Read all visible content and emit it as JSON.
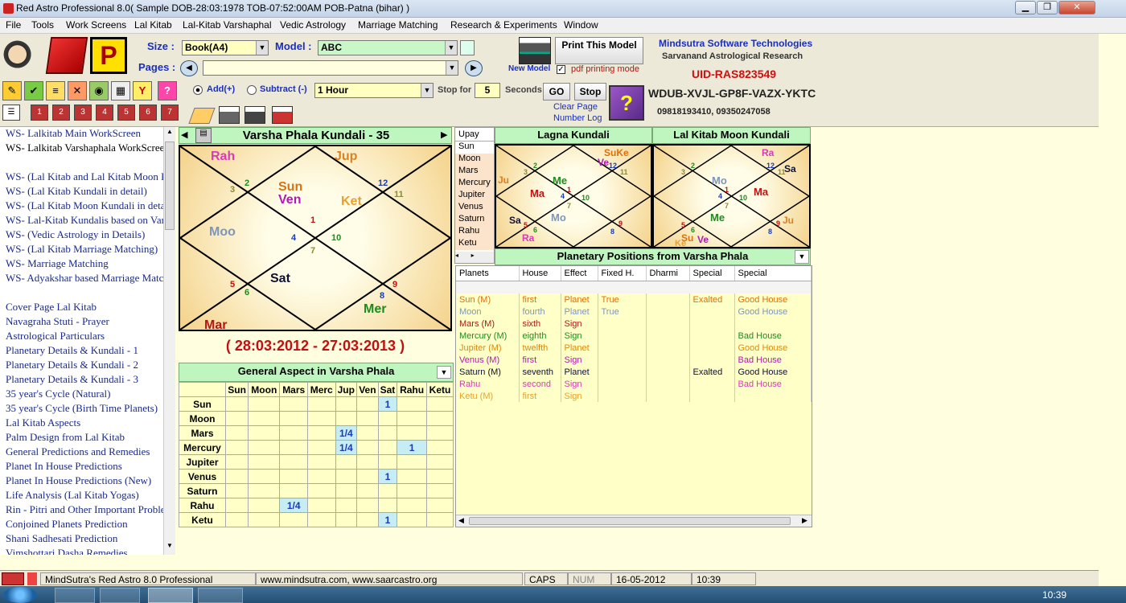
{
  "window": {
    "title": "Red Astro Professional 8.0( Sample DOB-28:03:1978 TOB-07:52:00AM POB-Patna (bihar) )",
    "minimize": "▁",
    "maximize": "❐",
    "close": "✕"
  },
  "menu": [
    "File",
    "Tools",
    "Work Screens",
    "Lal Kitab",
    "Lal-Kitab Varshaphal",
    "Vedic Astrology",
    "Marriage Matching",
    "Research & Experiments",
    "Window"
  ],
  "toolbar": {
    "size_label": "Size :",
    "size_value": "Book(A4)",
    "model_label": "Model :",
    "model_value": "ABC",
    "pages_label": "Pages :",
    "pages_value": "",
    "new_model": "New Model",
    "print_this_model": "Print This Model",
    "pdf_mode": "pdf printing mode",
    "company": "Mindsutra Software Technologies",
    "research": "Sarvanand Astrological Research",
    "uid": "UID-RAS823549",
    "key": "WDUB-XVJL-GP8F-VAZX-YKTC",
    "phones": "09818193410, 09350247058",
    "add": "Add(+)",
    "subtract": "Subtract (-)",
    "interval": "1 Hour",
    "stop_for": "Stop for",
    "seconds_value": "5",
    "seconds": "Seconds",
    "go": "GO",
    "stop": "Stop",
    "clear_page": "Clear Page",
    "number_log": "Number Log"
  },
  "sidebar": {
    "items": [
      "WS- Lalkitab Main WorkScreen",
      "WS- Lalkitab Varshaphala WorkScreen",
      "",
      "WS- (Lal Kitab and Lal Kitab Moon Kundali)",
      "WS- (Lal Kitab Kundali in detail)",
      "WS- (Lal Kitab Moon Kundali in detail)",
      "WS- Lal-Kitab Kundalis based on Varsha",
      "WS- (Vedic Astrology in Details)",
      "WS- (Lal Kitab Marriage Matching)",
      "WS- Marriage Matching",
      "WS- Adyakshar based Marriage Matching",
      "",
      "Cover Page Lal Kitab",
      "Navagraha Stuti - Prayer",
      "Astrological Particulars",
      "Planetary Details & Kundali - 1",
      "Planetary Details & Kundali - 2",
      "Planetary Details & Kundali - 3",
      "35 year's Cycle (Natural)",
      "35 year's Cycle (Birth Time Planets)",
      "Lal Kitab Aspects",
      "Palm Design from Lal Kitab",
      "General Predictions and Remedies",
      "Planet In House Predictions",
      "Planet In House Predictions (New)",
      "Life Analysis (Lal Kitab Yogas)",
      "Rin - Pitri and Other Important Problems",
      "Conjoined Planets Prediction",
      "Shani Sadhesati Prediction",
      "Vimshottari Dasha Remedies"
    ]
  },
  "varsha": {
    "title": "Varsha Phala Kundali - 35",
    "period": "( 28:03:2012 - 27:03:2013 )"
  },
  "upay": {
    "header": "Upay",
    "items": [
      "Sun",
      "Moon",
      "Mars",
      "Mercury",
      "Jupiter",
      "Venus",
      "Saturn",
      "Rahu",
      "Ketu"
    ]
  },
  "lagna": {
    "title": "Lagna Kundali"
  },
  "moon": {
    "title": "Lal Kitab Moon Kundali"
  },
  "planetary": {
    "title": "Planetary Positions from Varsha Phala",
    "headers": [
      "Planets",
      "House",
      "Effect",
      "Fixed H.",
      "Dharmi",
      "Special",
      "Special"
    ],
    "rows": [
      {
        "c": [
          "Sun (M)",
          "first",
          "Planet",
          "True",
          "",
          "Exalted",
          "Good House"
        ],
        "color": "#d9720f"
      },
      {
        "c": [
          "Moon",
          "fourth",
          "Planet",
          "True",
          "",
          "",
          "Good House"
        ],
        "color": "#7f96b8"
      },
      {
        "c": [
          "Mars (M)",
          "sixth",
          "Sign",
          "",
          "",
          "",
          ""
        ],
        "color": "#b01818"
      },
      {
        "c": [
          "Mercury (M)",
          "eighth",
          "Sign",
          "",
          "",
          "",
          "Bad House"
        ],
        "color": "#1f8a1f"
      },
      {
        "c": [
          "Jupiter (M)",
          "twelfth",
          "Planet",
          "",
          "",
          "",
          "Good House"
        ],
        "color": "#d98b10"
      },
      {
        "c": [
          "Venus (M)",
          "first",
          "Sign",
          "",
          "",
          "",
          "Bad House"
        ],
        "color": "#b318b3"
      },
      {
        "c": [
          "Saturn (M)",
          "seventh",
          "Planet",
          "",
          "",
          "Exalted",
          "Good House"
        ],
        "color": "#101030"
      },
      {
        "c": [
          "Rahu",
          "second",
          "Sign",
          "",
          "",
          "",
          "Bad House"
        ],
        "color": "#d83ab8"
      },
      {
        "c": [
          "Ketu (M)",
          "first",
          "Sign",
          "",
          "",
          "",
          ""
        ],
        "color": "#e8a030"
      }
    ]
  },
  "aspect": {
    "title": "General Aspect in Varsha Phala",
    "cols": [
      "Sun",
      "Moon",
      "Mars",
      "Merc",
      "Jup",
      "Ven",
      "Sat",
      "Rahu",
      "Ketu"
    ],
    "rows": [
      {
        "name": "Sun",
        "vals": [
          "",
          "",
          "",
          "",
          "",
          "",
          "1",
          "",
          ""
        ]
      },
      {
        "name": "Moon",
        "vals": [
          "",
          "",
          "",
          "",
          "",
          "",
          "",
          "",
          ""
        ]
      },
      {
        "name": "Mars",
        "vals": [
          "",
          "",
          "",
          "",
          "1/4",
          "",
          "",
          "",
          ""
        ]
      },
      {
        "name": "Mercury",
        "vals": [
          "",
          "",
          "",
          "",
          "1/4",
          "",
          "",
          "1",
          ""
        ]
      },
      {
        "name": "Jupiter",
        "vals": [
          "",
          "",
          "",
          "",
          "",
          "",
          "",
          "",
          ""
        ]
      },
      {
        "name": "Venus",
        "vals": [
          "",
          "",
          "",
          "",
          "",
          "",
          "1",
          "",
          ""
        ]
      },
      {
        "name": "Saturn",
        "vals": [
          "",
          "",
          "",
          "",
          "",
          "",
          "",
          "",
          ""
        ]
      },
      {
        "name": "Rahu",
        "vals": [
          "",
          "",
          "1/4",
          "",
          "",
          "",
          "",
          "",
          ""
        ]
      },
      {
        "name": "Ketu",
        "vals": [
          "",
          "",
          "",
          "",
          "",
          "",
          "1",
          "",
          ""
        ]
      }
    ]
  },
  "status": {
    "app": "MindSutra's Red Astro 8.0 Professional",
    "web": "www.mindsutra.com, www.saarcastro.org",
    "caps": "CAPS",
    "num": "NUM",
    "date": "16-05-2012",
    "time": "10:39"
  },
  "taskbar": {
    "clock": "10:39"
  },
  "colors": {
    "green_header": "#bff5bf",
    "pale_yellow": "#ffffe0",
    "brand_blue": "#1a2fbf",
    "uid_red": "#d01010"
  }
}
